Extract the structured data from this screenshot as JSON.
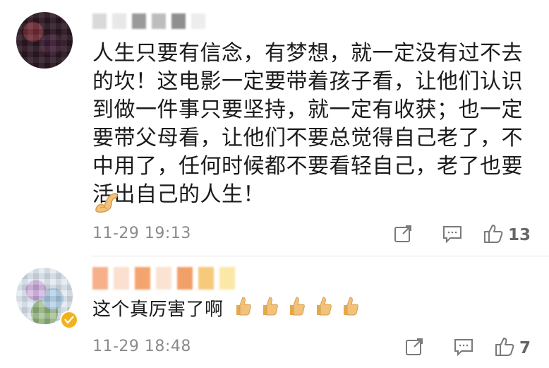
{
  "colors": {
    "text": "#1b1b1b",
    "meta": "#8a8a8a",
    "icon": "#7a7a7a",
    "verified_badge": "#f3b21a"
  },
  "comments": [
    {
      "username_redacted": true,
      "text": "人生只要有信念，有梦想，就一定没有过不去的坎！这电影一定要带着孩子看，让他们认识到做一件事只要坚持，就一定有收获；也一定要带父母看，让他们不要总觉得自己老了，不中用了，任何时候都不要看轻自己，老了也要活出自己的人生！",
      "emoji": [
        "flexed-biceps"
      ],
      "timestamp": "11-29 19:13",
      "likes": "13",
      "icons": {
        "share": "share-icon",
        "comment": "comment-icon",
        "like": "thumbs-up-icon"
      }
    },
    {
      "username_redacted": true,
      "verified": true,
      "text": "这个真厉害了啊",
      "emoji": [
        "thumbs-up",
        "thumbs-up",
        "thumbs-up",
        "thumbs-up",
        "thumbs-up"
      ],
      "timestamp": "11-29 18:48",
      "likes": "7",
      "icons": {
        "share": "share-icon",
        "comment": "comment-icon",
        "like": "thumbs-up-icon"
      }
    }
  ]
}
